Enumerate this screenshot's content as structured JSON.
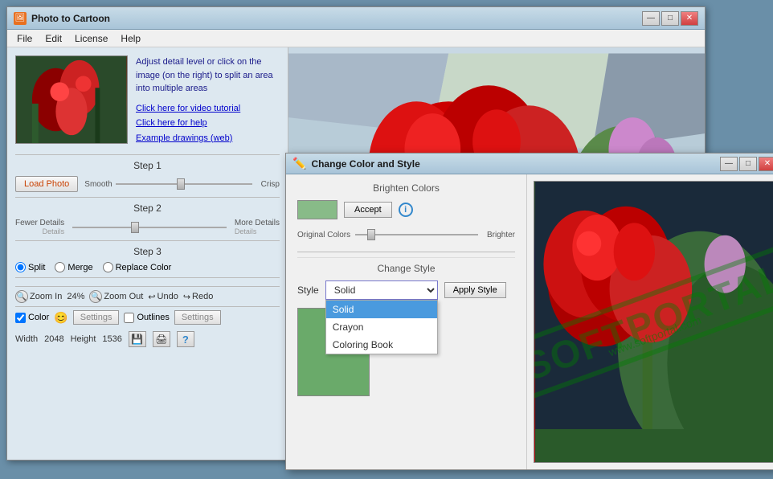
{
  "mainWindow": {
    "title": "Photo to Cartoon",
    "controls": {
      "minimize": "—",
      "maximize": "□",
      "close": "✕"
    }
  },
  "menuBar": {
    "items": [
      "File",
      "Edit",
      "License",
      "Help"
    ]
  },
  "leftPanel": {
    "instructions": {
      "main": "Adjust detail level or click on the image (on the right) to split an area into multiple areas",
      "link1": "Click here for video tutorial",
      "link2": "Click here for help",
      "link3": "Example drawings (web)"
    },
    "step1": {
      "label": "Step 1",
      "loadPhoto": "Load Photo",
      "smooth": "Smooth",
      "crisp": "Crisp",
      "sliderPos": 50
    },
    "step2": {
      "label": "Step 2",
      "fewerDetails": "Fewer Details",
      "moreDetails": "More Details",
      "sliderPos": 40
    },
    "step3": {
      "label": "Step 3",
      "split": "Split",
      "merge": "Merge",
      "replaceColor": "Replace Color"
    },
    "zoom": {
      "zoomIn": "Zoom In",
      "percent": "24%",
      "zoomOut": "Zoom Out",
      "undo": "Undo",
      "redo": "Redo"
    },
    "options": {
      "colorLabel": "Color",
      "settingsLabel": "Settings",
      "outlinesLabel": "Outlines",
      "settingsLabel2": "Settings"
    },
    "size": {
      "widthLabel": "Width",
      "widthValue": "2048",
      "heightLabel": "Height",
      "heightValue": "1536"
    }
  },
  "secondaryWindow": {
    "title": "Change Color and Style",
    "controls": {
      "minimize": "—",
      "maximize": "□",
      "close": "✕"
    },
    "colorSection": {
      "title": "Brighten Colors",
      "colorSwatchColor": "#88bb88",
      "acceptLabel": "Accept",
      "originalColors": "Original Colors",
      "brighter": "Brighter"
    },
    "styleSection": {
      "title": "Change Style",
      "styleLabel": "Style",
      "currentStyle": "Solid",
      "applyLabel": "Apply Style",
      "options": [
        "Solid",
        "Crayon",
        "Coloring Book"
      ]
    }
  },
  "watermark": {
    "text": "SOFTPORTAL",
    "subtext": "www.softportal.com"
  }
}
